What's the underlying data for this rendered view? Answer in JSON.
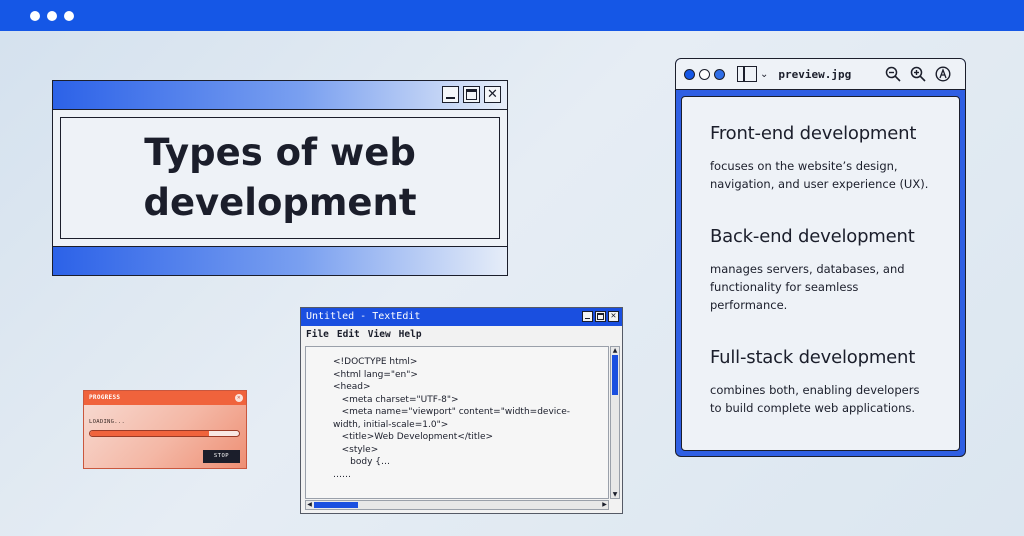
{
  "title_window": {
    "heading_line1": "Types of web",
    "heading_line2": "development",
    "buttons": {
      "minimize": "",
      "maximize": "",
      "close": "✕"
    }
  },
  "preview": {
    "filename": "preview.jpg",
    "sections": [
      {
        "title": "Front-end development",
        "body": "focuses on the website’s design, navigation, and user experience (UX)."
      },
      {
        "title": "Back-end development",
        "body": "manages servers, databases, and functionality for seamless performance."
      },
      {
        "title": "Full-stack development",
        "body": "combines both, enabling developers to build complete web applications."
      }
    ]
  },
  "textedit": {
    "title": "Untitled - TextEdit",
    "menu": [
      "File",
      "Edit",
      "View",
      "Help"
    ],
    "code_lines": [
      "<!DOCTYPE html>",
      "<html lang=\"en\">",
      "<head>",
      "   <meta charset=\"UTF-8\">",
      "   <meta name=\"viewport\" content=\"width=device-",
      "width, initial-scale=1.0\">",
      "   <title>Web Development</title>",
      "   <style>",
      "      body {…",
      "……"
    ]
  },
  "progress": {
    "title": "PROGRESS",
    "status": "LOADING...",
    "fraction": 0.8,
    "stop_label": "STOP"
  },
  "colors": {
    "accent": "#1557e6",
    "progress": "#f0633c"
  }
}
